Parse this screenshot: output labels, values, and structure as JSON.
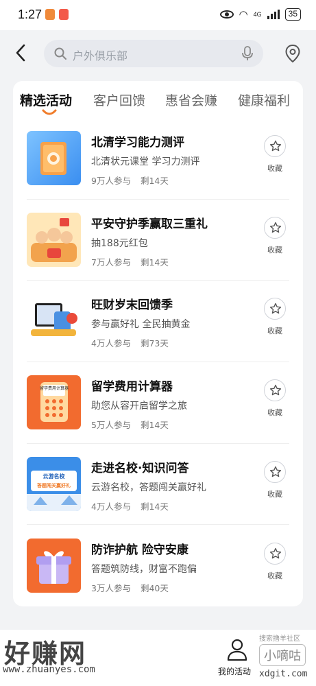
{
  "status_bar": {
    "time": "1:27",
    "network": "4G",
    "battery": "35"
  },
  "search": {
    "placeholder": "户外俱乐部"
  },
  "tabs": [
    {
      "label": "精选活动",
      "active": true
    },
    {
      "label": "客户回馈",
      "active": false
    },
    {
      "label": "惠省会赚",
      "active": false
    },
    {
      "label": "健康福利",
      "active": false
    }
  ],
  "items": [
    {
      "title": "北清学习能力测评",
      "subtitle": "北清状元课堂 学习力测评",
      "participants": "9万人参与",
      "remaining": "剩14天",
      "fav_label": "收藏"
    },
    {
      "title": "平安守护季赢取三重礼",
      "subtitle": "抽188元红包",
      "participants": "7万人参与",
      "remaining": "剩14天",
      "fav_label": "收藏"
    },
    {
      "title": "旺财岁末回馈季",
      "subtitle": "参与赢好礼 全民抽黄金",
      "participants": "4万人参与",
      "remaining": "剩73天",
      "fav_label": "收藏"
    },
    {
      "title": "留学费用计算器",
      "subtitle": "助您从容开启留学之旅",
      "participants": "5万人参与",
      "remaining": "剩14天",
      "fav_label": "收藏",
      "thumb_text": "留学费用计算器"
    },
    {
      "title": "走进名校·知识问答",
      "subtitle": "云游名校，答题闯关赢好礼",
      "participants": "4万人参与",
      "remaining": "剩14天",
      "fav_label": "收藏",
      "thumb_text_1": "云游名校",
      "thumb_text_2": "答题闯关赢好礼"
    },
    {
      "title": "防诈护航 险守安康",
      "subtitle": "答题筑防线，财富不跑偏",
      "participants": "3万人参与",
      "remaining": "剩40天",
      "fav_label": "收藏"
    }
  ],
  "bottom": {
    "my_activities": "我的活动",
    "watermark_brand": "好赚网",
    "watermark_url": "www.zhuanyes.com",
    "watermark_community": "搜索撸羊社区",
    "watermark_name": "小嘀咕",
    "watermark_url2": "xdgit.com"
  },
  "colors": {
    "accent": "#f07c2a",
    "background": "#f2f3f5"
  }
}
